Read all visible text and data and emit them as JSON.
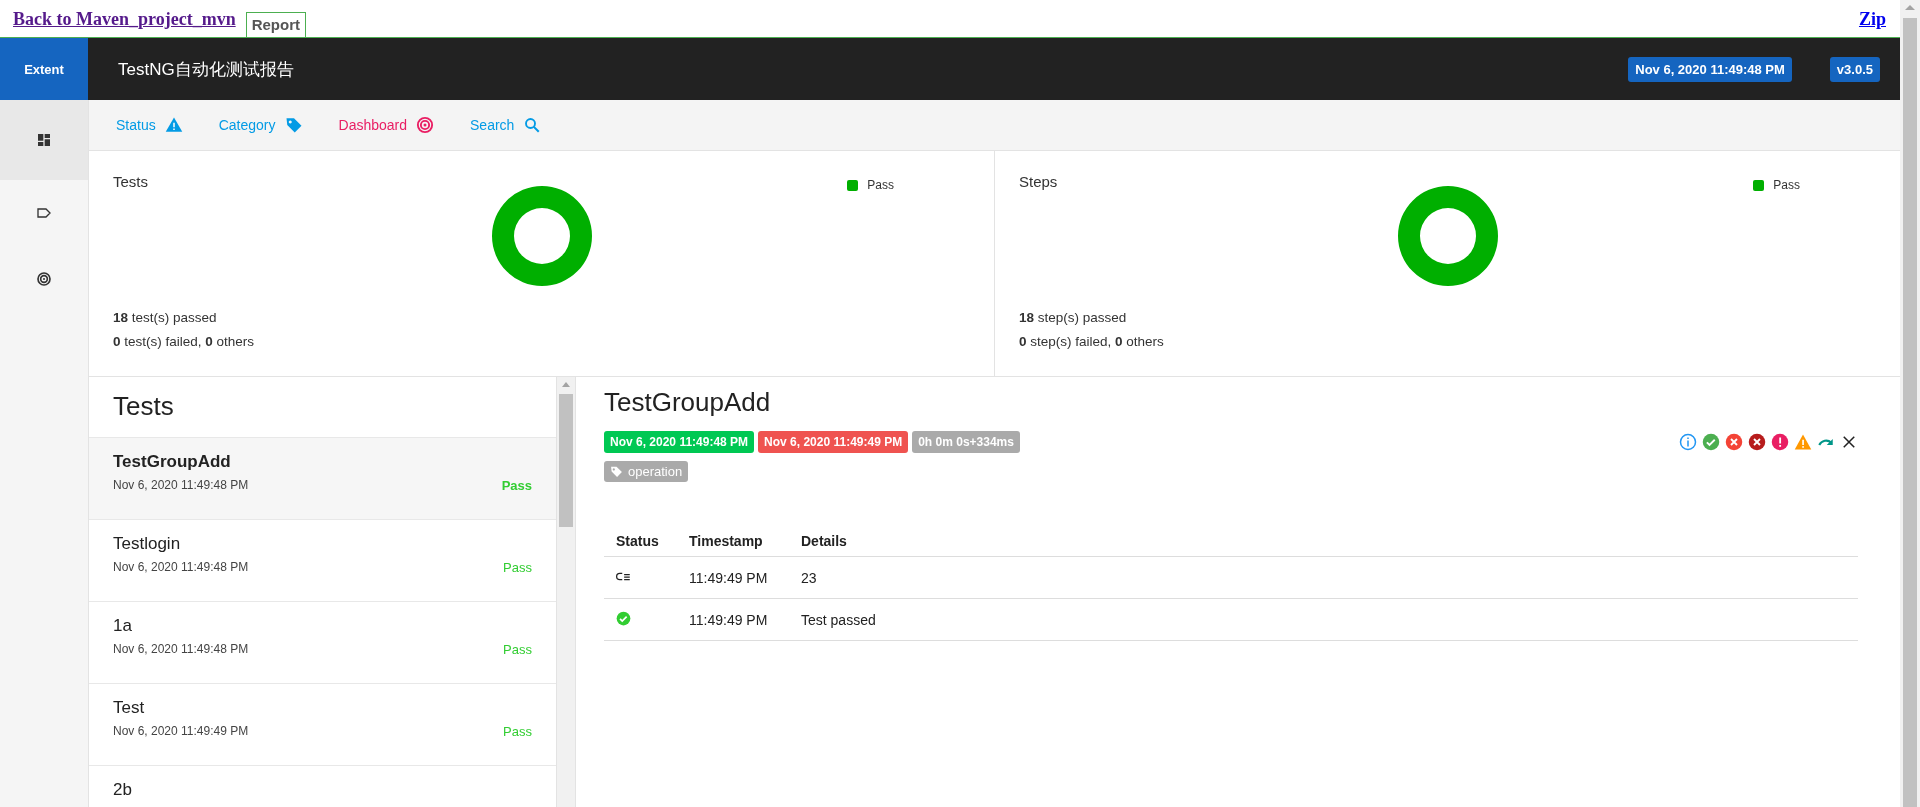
{
  "top_bar": {
    "back_link": "Back to Maven_project_mvn",
    "tab": "Report",
    "zip_link": "Zip"
  },
  "header": {
    "logo": "Extent",
    "title": "TestNG自动化测试报告",
    "date": "Nov 6, 2020 11:49:48 PM",
    "version": "v3.0.5"
  },
  "sidebar": {
    "items": [
      {
        "kind": "dashboard",
        "selected": true
      },
      {
        "kind": "tag",
        "selected": false
      },
      {
        "kind": "target",
        "selected": false
      }
    ]
  },
  "nav": {
    "items": [
      {
        "label": "Status",
        "kind": "status",
        "selected": false
      },
      {
        "label": "Category",
        "kind": "category",
        "selected": false
      },
      {
        "label": "Dashboard",
        "kind": "dashboard",
        "selected": true
      },
      {
        "label": "Search",
        "kind": "search",
        "selected": false
      }
    ]
  },
  "summary": [
    {
      "title": "Tests",
      "legend": [
        {
          "label": "Pass",
          "color": "#00af00"
        }
      ],
      "passed_line": "**18** test(s) passed",
      "failed_line": "**0** test(s) failed, **0** others"
    },
    {
      "title": "Steps",
      "legend": [
        {
          "label": "Pass",
          "color": "#00af00"
        }
      ],
      "passed_line": "**18** step(s) passed",
      "failed_line": "**0** step(s) failed, **0** others"
    }
  ],
  "test_list": {
    "title": "Tests",
    "items": [
      {
        "name": "TestGroupAdd",
        "time": "Nov 6, 2020 11:49:48 PM",
        "status": "Pass",
        "selected": true
      },
      {
        "name": "Testlogin",
        "time": "Nov 6, 2020 11:49:48 PM",
        "status": "Pass",
        "selected": false
      },
      {
        "name": "1a",
        "time": "Nov 6, 2020 11:49:48 PM",
        "status": "Pass",
        "selected": false
      },
      {
        "name": "Test",
        "time": "Nov 6, 2020 11:49:49 PM",
        "status": "Pass",
        "selected": false
      },
      {
        "name": "2b",
        "selected": false
      }
    ]
  },
  "detail": {
    "title": "TestGroupAdd",
    "start": "Nov 6, 2020 11:49:48 PM",
    "end": "Nov 6, 2020 11:49:49 PM",
    "duration": "0h 0m 0s+334ms",
    "category": "operation",
    "filters": [
      {
        "kind": "info"
      },
      {
        "kind": "pass"
      },
      {
        "kind": "fail"
      },
      {
        "kind": "fatal"
      },
      {
        "kind": "error"
      },
      {
        "kind": "warning"
      },
      {
        "kind": "skip"
      },
      {
        "kind": "clear"
      }
    ],
    "table": {
      "columns": [
        "Status",
        "Timestamp",
        "Details"
      ],
      "rows": [
        {
          "kind": "info",
          "timestamp": "11:49:49 PM",
          "details": "23"
        },
        {
          "kind": "pass",
          "timestamp": "11:49:49 PM",
          "details": "Test passed"
        }
      ]
    }
  }
}
